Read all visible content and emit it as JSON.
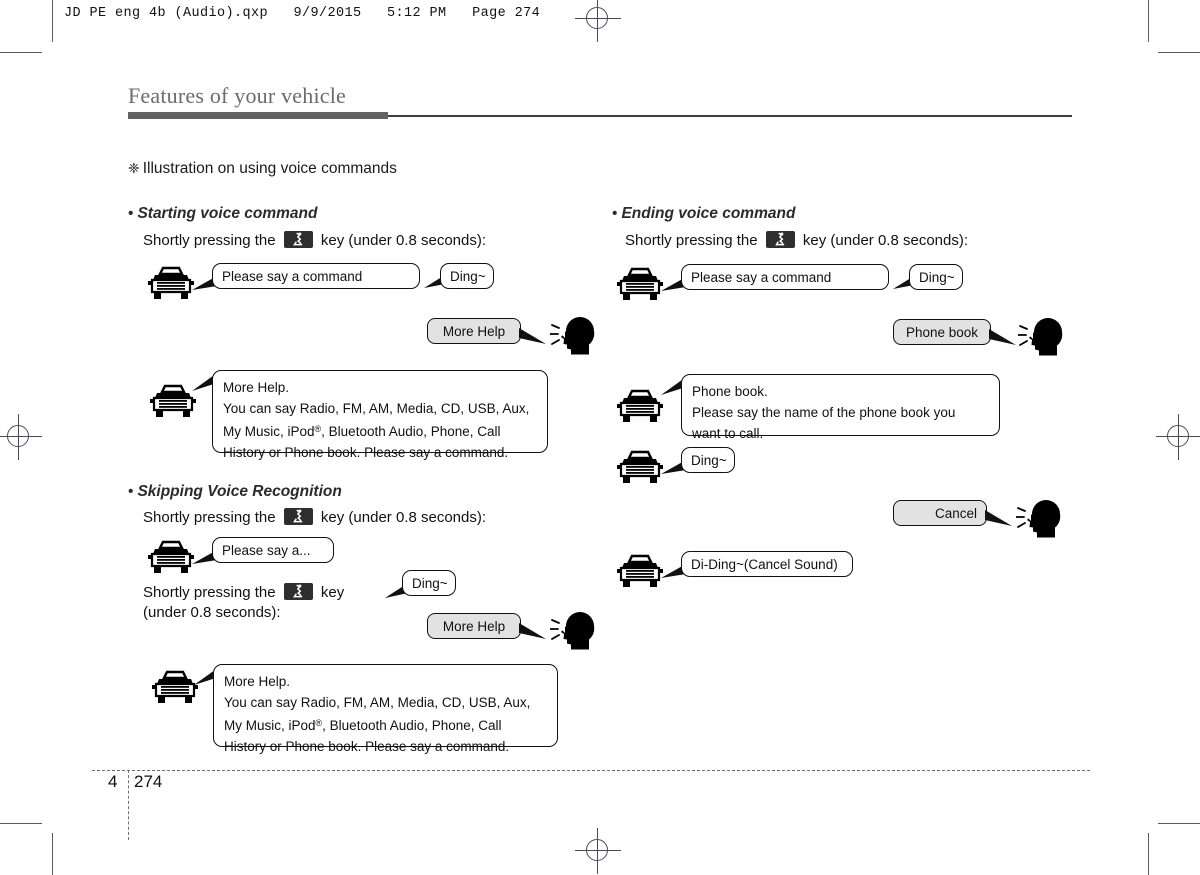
{
  "print_marks": {
    "qxp_header": "JD PE eng 4b (Audio).qxp   9/9/2015   5:12 PM   Page 274"
  },
  "page": {
    "chapter_title": "Features of your vehicle",
    "section_heading": "Illustration on using voice commands",
    "section_symbol": "❈",
    "footer_chapter": "4",
    "footer_page": "274"
  },
  "icons": {
    "car": "car-front-icon",
    "head": "talking-head-icon",
    "voice_key": "voice-recognition-key-icon"
  },
  "left_column": {
    "sections": [
      {
        "bullet": "•",
        "title": "Starting voice command",
        "press_line": "Shortly pressing the",
        "press_line_tail": "key (under 0.8 seconds):",
        "bubbles": {
          "please_say": "Please say a command",
          "ding": "Ding~",
          "more_help_user": "More Help",
          "more_help_title": "More Help.",
          "more_help_body_line1": "You can say Radio, FM, AM, Media, CD, USB, Aux,",
          "more_help_body_line2a": "My Music, iPod",
          "more_help_body_line2b": ", Bluetooth Audio, Phone, Call",
          "more_help_body_line3": "History or Phone book. Please say a command."
        }
      },
      {
        "bullet": "•",
        "title": "Skipping Voice Recognition",
        "press_line": "Shortly pressing the",
        "press_line_tail": "key (under 0.8 seconds):",
        "press_line2": "Shortly pressing the",
        "press_line2_tail": "key",
        "press_line2_second": "(under 0.8 seconds):",
        "bubbles": {
          "please_say_partial": "Please say a...",
          "ding": "Ding~",
          "more_help_user": "More Help",
          "more_help_title": "More Help.",
          "more_help_body_line1": "You can say Radio, FM, AM, Media, CD, USB, Aux,",
          "more_help_body_line2a": "My Music, iPod",
          "more_help_body_line2b": ", Bluetooth Audio, Phone, Call",
          "more_help_body_line3": "History or Phone book. Please say a command."
        }
      }
    ]
  },
  "right_column": {
    "sections": [
      {
        "bullet": "•",
        "title": "Ending voice command",
        "press_line": "Shortly pressing the",
        "press_line_tail": "key (under 0.8 seconds):",
        "bubbles": {
          "please_say": "Please say a command",
          "ding": "Ding~",
          "phone_book_user": "Phone book",
          "phone_book_title": "Phone book.",
          "phone_book_body_line1": "Please say the name of the phone book you",
          "phone_book_body_line2": "want to call.",
          "ding2": "Ding~",
          "cancel_user": "Cancel",
          "di_ding": "Di-Ding~(Cancel Sound)"
        }
      }
    ]
  },
  "colors": {
    "rule": "#636363",
    "title_gray": "#6b6b6b",
    "user_bubble_fill": "#e2e2e2",
    "key_fill": "#2e2e2e"
  },
  "superscripts": {
    "registered": "®"
  }
}
